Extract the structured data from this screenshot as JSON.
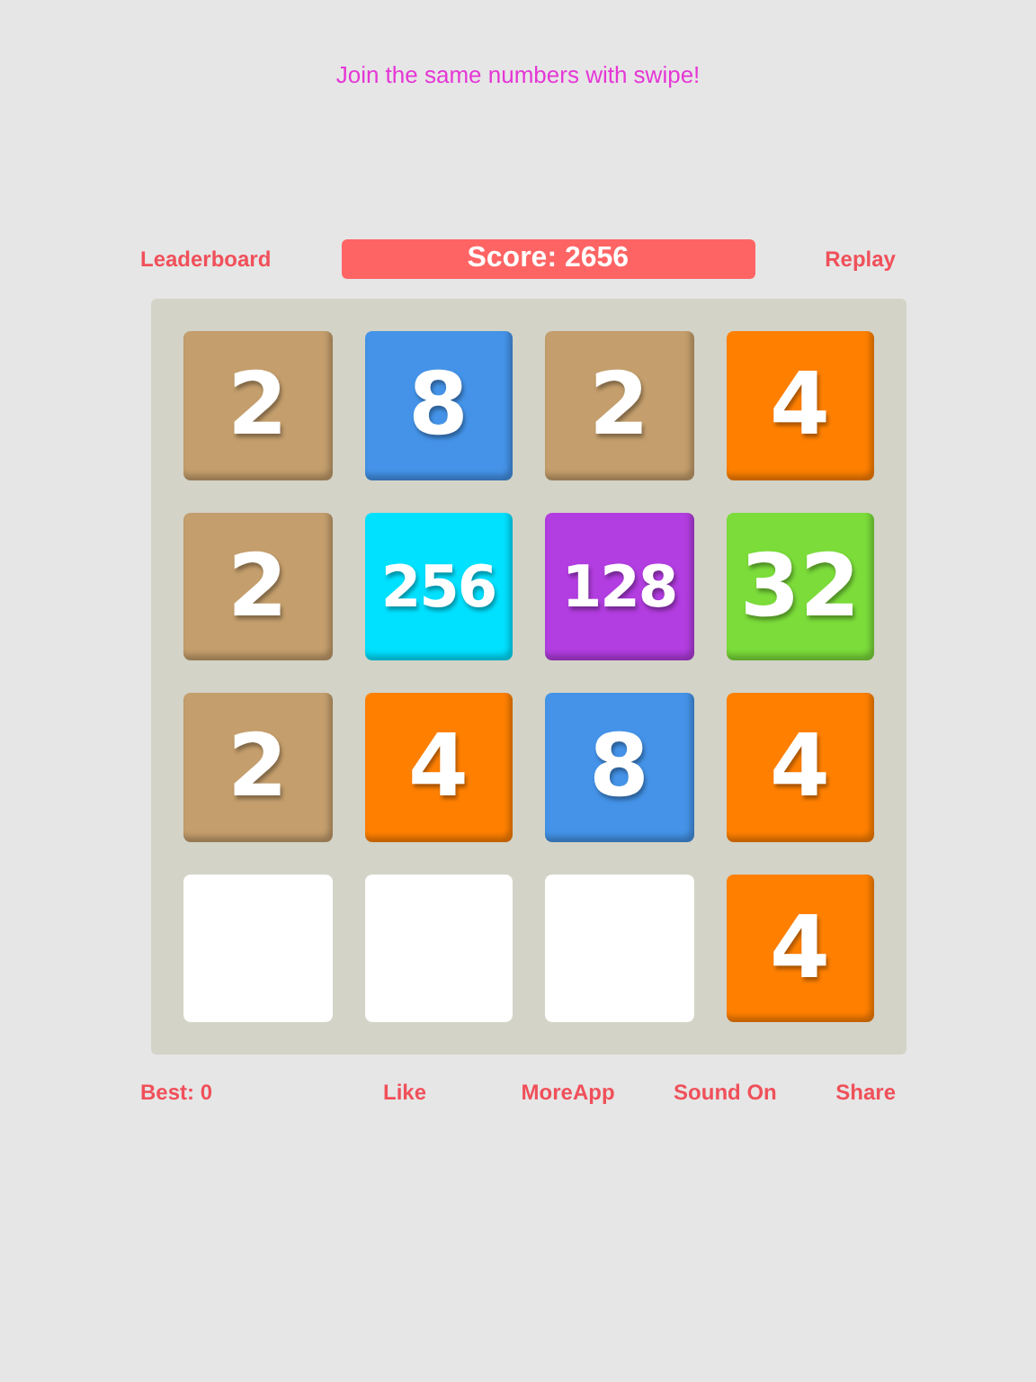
{
  "hint": "Join the same numbers with swipe!",
  "header": {
    "left_link": "Leaderboard",
    "score": "Score: 2656",
    "right_link": "Replay"
  },
  "board": {
    "tiles": [
      {
        "kind": "number",
        "value": "2",
        "color": "#c49e6c"
      },
      {
        "kind": "number",
        "value": "8",
        "color": "#4493e8"
      },
      {
        "kind": "number",
        "value": "2",
        "color": "#c49e6c"
      },
      {
        "kind": "number",
        "value": "4",
        "color": "#ff8000"
      },
      {
        "kind": "number",
        "value": "2",
        "color": "#c49e6c"
      },
      {
        "kind": "number",
        "value": "256",
        "color": "#00e1ff"
      },
      {
        "kind": "number",
        "value": "128",
        "color": "#b23de0"
      },
      {
        "kind": "number",
        "value": "32",
        "color": "#7bdc3a"
      },
      {
        "kind": "number",
        "value": "2",
        "color": "#c49e6c"
      },
      {
        "kind": "number",
        "value": "4",
        "color": "#ff8000"
      },
      {
        "kind": "number",
        "value": "8",
        "color": "#4493e8"
      },
      {
        "kind": "number",
        "value": "4",
        "color": "#ff8000"
      },
      {
        "kind": "empty"
      },
      {
        "kind": "empty"
      },
      {
        "kind": "empty"
      },
      {
        "kind": "number",
        "value": "4",
        "color": "#ff8000"
      }
    ]
  },
  "footer": {
    "best": "Best: 0",
    "links": [
      "Like",
      "MoreApp",
      "Sound On",
      "Share"
    ]
  }
}
